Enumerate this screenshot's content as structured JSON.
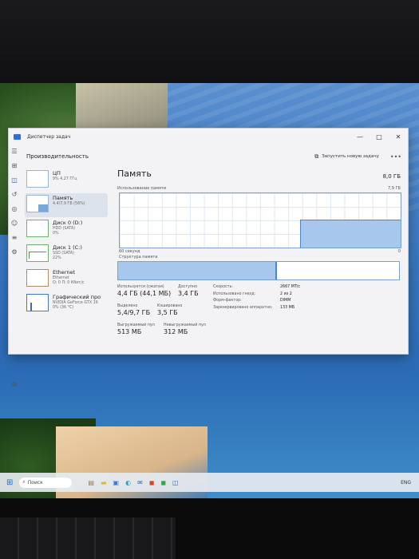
{
  "window": {
    "title": "Диспетчер задач",
    "controls": [
      "—",
      "□",
      "✕"
    ]
  },
  "header": {
    "title": "Производительность",
    "run_task": "Запустить новую задачу",
    "more": "•••"
  },
  "perf_items": [
    {
      "name": "ЦП",
      "sub": "9%  4,27 ГГц"
    },
    {
      "name": "Память",
      "sub": "4,4/7,9 ГБ (56%)"
    },
    {
      "name": "Диск 0 (D:)",
      "sub": "HDD (SATA)",
      "sub2": "0%"
    },
    {
      "name": "Диск 1 (C:)",
      "sub": "SSD (SATA)",
      "sub2": "22%"
    },
    {
      "name": "Ethernet",
      "sub": "Ethernet",
      "sub2": "О: 0 П: 0 Кбит/с"
    },
    {
      "name": "Графический про",
      "sub": "NVIDIA GeForce GTX 16",
      "sub2": "0% (36 °C)"
    }
  ],
  "memory": {
    "title": "Память",
    "total": "8,0 ГБ",
    "usage_label": "Использование памяти",
    "usage_max": "7,9 ГБ",
    "seconds": "60 секунд",
    "zero": "0",
    "structure_label": "Структура памяти",
    "used_fraction": 0.56,
    "in_use_label": "Используется (сжатая)",
    "in_use_value": "4,4 ГБ (44,1 МБ)",
    "available_label": "Доступно",
    "available_value": "3,4 ГБ",
    "committed_label": "Выделено",
    "committed_value": "5,4/9,7 ГБ",
    "cached_label": "Кэшировано",
    "cached_value": "3,5 ГБ",
    "paged_label": "Выгружаемый пул",
    "paged_value": "513 МБ",
    "nonpaged_label": "Невыгружаемый пул",
    "nonpaged_value": "312 МБ",
    "speed_label": "Скорость:",
    "speed_value": "2667 МТ/с",
    "slots_label": "Использовано гнезд:",
    "slots_value": "2 из 2",
    "form_label": "Форм-фактор:",
    "form_value": "DIMM",
    "reserved_label": "Зарезервировано аппаратно:",
    "reserved_value": "133 МБ"
  },
  "taskbar": {
    "search": "Поиск",
    "lang": "ENG"
  }
}
